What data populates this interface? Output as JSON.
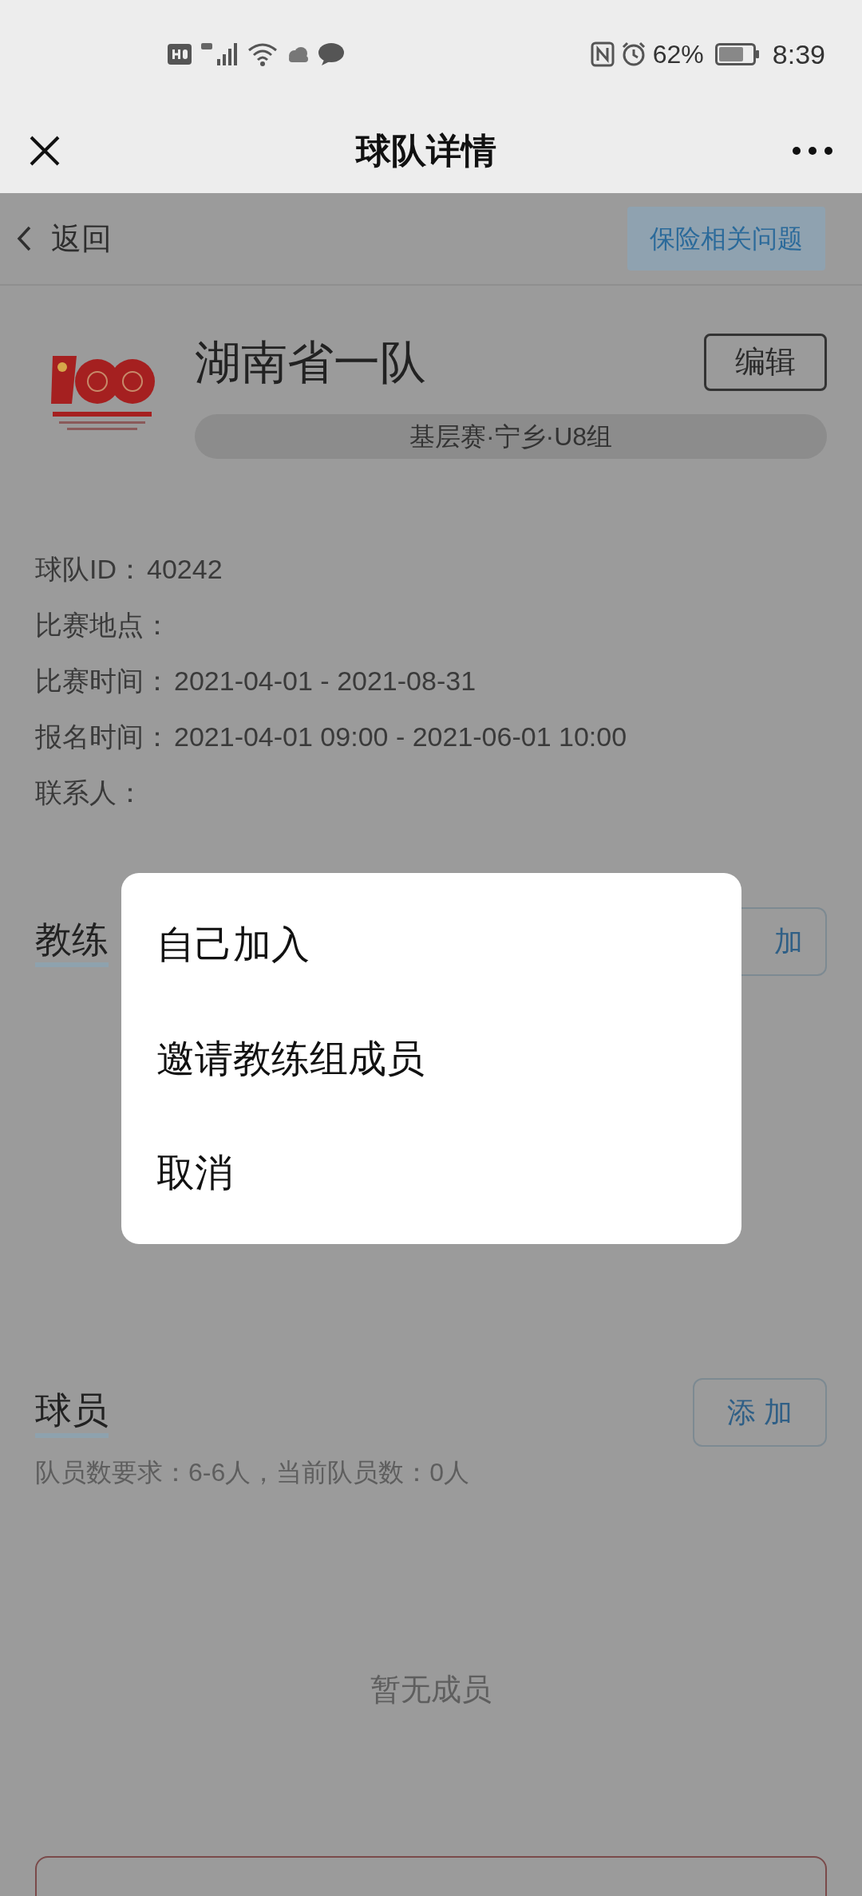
{
  "status_bar": {
    "battery": "62%",
    "time": "8:39"
  },
  "nav_bar": {
    "title": "球队详情"
  },
  "top_bar": {
    "back": "返回",
    "link": "保险相关问题"
  },
  "team": {
    "name": "湖南省一队",
    "edit_button": "编辑",
    "group": "基层赛·宁乡·U8组"
  },
  "info": [
    {
      "label": "球队ID：",
      "value": "40242"
    },
    {
      "label": "比赛地点："
    },
    {
      "label": "比赛时间：",
      "value": "2021-04-01 - 2021-08-31"
    },
    {
      "label": "报名时间：",
      "value": "2021-04-01 09:00 - 2021-06-01 10:00"
    },
    {
      "label": "联系人："
    }
  ],
  "coach_section": {
    "title": "教练",
    "add_button": "加"
  },
  "players_section": {
    "title": "球员",
    "add_button": "添 加",
    "requirement": "队员数要求：6-6人，当前队员数：0人",
    "empty": "暂无成员"
  },
  "action_sheet": {
    "items": [
      "自己加入",
      "邀请教练组成员",
      "取消"
    ]
  }
}
